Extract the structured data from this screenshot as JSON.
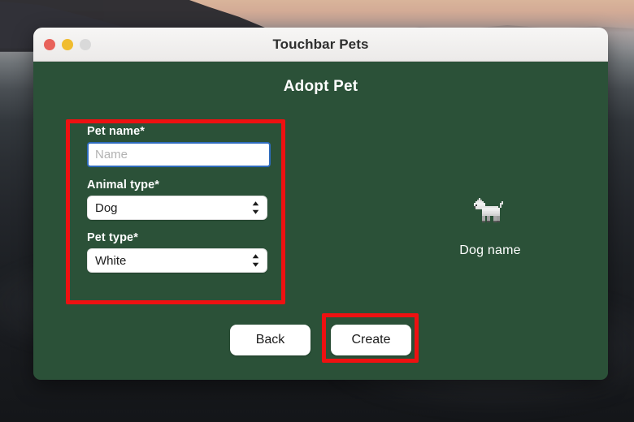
{
  "desktop": {
    "wallpaper_description": "mountain sunset photo",
    "sky_color": "#d3ab96",
    "ridge_color": "#2b2b30"
  },
  "window": {
    "title": "Touchbar Pets",
    "panel_color": "#2b5138",
    "traffic_lights": [
      {
        "name": "close",
        "color": "#e8625a"
      },
      {
        "name": "minimize",
        "color": "#f0bc2e"
      },
      {
        "name": "zoom",
        "color": "#d9d9d9"
      }
    ]
  },
  "page": {
    "heading": "Adopt Pet"
  },
  "form": {
    "fields": [
      {
        "label": "Pet name*",
        "type": "text",
        "value": "",
        "placeholder": "Name",
        "focused": true,
        "focus_color": "#2e6bbd"
      },
      {
        "label": "Animal type*",
        "type": "select",
        "value": "Dog",
        "options": [
          "Dog"
        ]
      },
      {
        "label": "Pet type*",
        "type": "select",
        "value": "White",
        "options": [
          "White"
        ]
      }
    ]
  },
  "preview": {
    "sprite_name": "white-dog-sprite",
    "caption": "Dog name"
  },
  "actions": {
    "back_label": "Back",
    "create_label": "Create"
  },
  "annotations": {
    "color": "#ee1111",
    "boxes": [
      {
        "name": "form-fields",
        "target": "pet name, animal type and pet type fields"
      },
      {
        "name": "create-button",
        "target": "Create button"
      }
    ]
  }
}
